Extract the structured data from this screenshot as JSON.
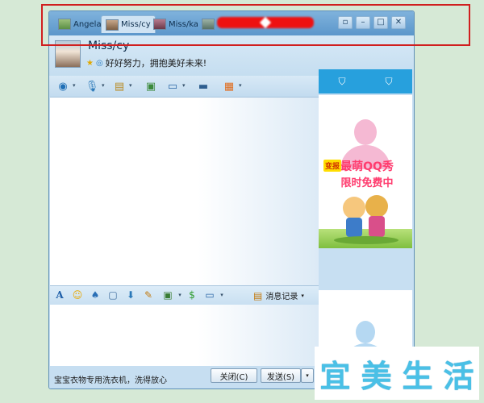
{
  "tabs": [
    {
      "label": "Angela"
    },
    {
      "label": "Miss/cy"
    },
    {
      "label": "Miss/ka"
    }
  ],
  "contact": {
    "nickname": "Miss/cy",
    "signature": "好好努力，拥抱美好未来!"
  },
  "input": {
    "history_label": "消息记录"
  },
  "bottom": {
    "ad_text": "宝宝衣物专用洗衣机，洗得放心",
    "close_label": "关闭(C)",
    "send_label": "发送(S)"
  },
  "side_ad": {
    "tag": "变报",
    "line1": "最萌QQ秀",
    "line2": "限时免费中"
  },
  "watermark": [
    "宜",
    "美",
    "生",
    "活"
  ],
  "colors": {
    "accent": "#5c97cb",
    "annotation": "#d01f1f",
    "watermark": "#4ac0e6"
  }
}
